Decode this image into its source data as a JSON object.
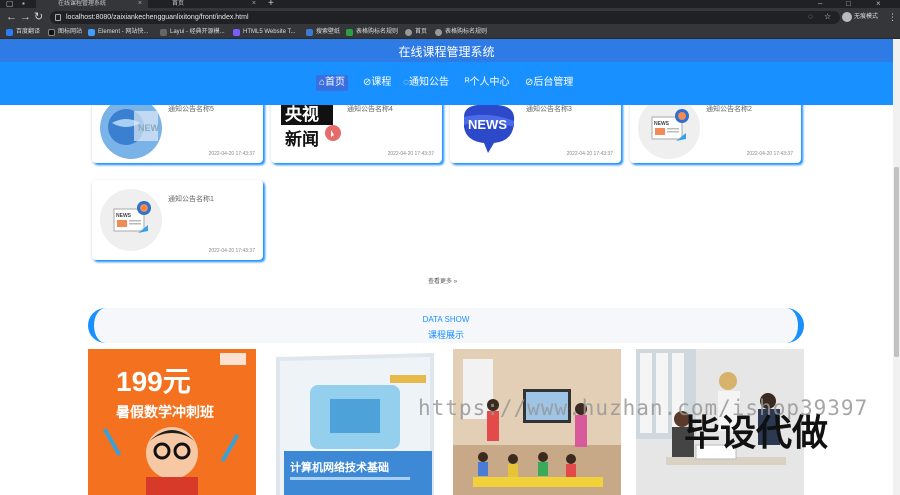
{
  "browser": {
    "tabs": [
      {
        "title": "在线课程管理系统"
      },
      {
        "title": "首页"
      }
    ],
    "url": "localhost:8080/zaixiankechengguanlixitong/front/index.html",
    "profile_label": "无痕模式",
    "bookmarks": [
      {
        "label": "百度翻译",
        "color": "#2d7cf6"
      },
      {
        "label": "图标网站",
        "color": "#111111"
      },
      {
        "label": "Element - 网站快...",
        "color": "#409eff"
      },
      {
        "label": "Layui - 经典开源模...",
        "color": "#666666"
      },
      {
        "label": "HTML5 Website T...",
        "color": "#7a5cff"
      },
      {
        "label": "搜索壁纸",
        "color": "#3a7bd5"
      },
      {
        "label": "表格购标名规则",
        "color": "#2e9e44"
      },
      {
        "label": "首页",
        "color": "#999999"
      },
      {
        "label": "表格购标名规则",
        "color": "#999999"
      }
    ]
  },
  "header": {
    "site_title": "在线课程管理系统",
    "nav": [
      {
        "label": "首页",
        "icon": "home-icon",
        "active": true
      },
      {
        "label": "课程",
        "icon": "link-icon",
        "active": false
      },
      {
        "label": "通知公告",
        "icon": "notice-icon",
        "active": false
      },
      {
        "label": "个人中心",
        "icon": "user-icon",
        "active": false
      },
      {
        "label": "后台管理",
        "icon": "link-icon",
        "active": false
      }
    ]
  },
  "notices": [
    {
      "title": "通知公告名称5",
      "date": "2022-04-20 17:43:37",
      "image": "globe-news"
    },
    {
      "title": "通知公告名称4",
      "date": "2022-04-20 17:43:37",
      "image": "cctv-news"
    },
    {
      "title": "通知公告名称3",
      "date": "2022-04-20 17:43:37",
      "image": "news-bubble"
    },
    {
      "title": "通知公告名称2",
      "date": "2022-04-20 17:43:37",
      "image": "news-paper"
    },
    {
      "title": "通知公告名称1",
      "date": "2022-04-20 17:43:37",
      "image": "news-paper"
    }
  ],
  "cctv_text": {
    "line1": "央视",
    "line2": "新闻"
  },
  "news_word": "NEWS",
  "more_label": "查看更多",
  "data_show": {
    "en": "DATA SHOW",
    "cn": "课程展示"
  },
  "courses": [
    {
      "name": "暑假数学冲刺班",
      "price": "199元",
      "image": "math-poster"
    },
    {
      "name": "计算机网络技术基础",
      "image": "book-cover"
    },
    {
      "name": "classroom",
      "image": "classroom-photo"
    },
    {
      "name": "art-class",
      "image": "art-photo"
    }
  ],
  "watermark": {
    "url": "https://www.huzhan.com/ishop39397",
    "cn": "毕设代做"
  },
  "colors": {
    "primary": "#1890ff",
    "title_strip": "#2f7be6",
    "nav_active": "#3a6fe0"
  }
}
